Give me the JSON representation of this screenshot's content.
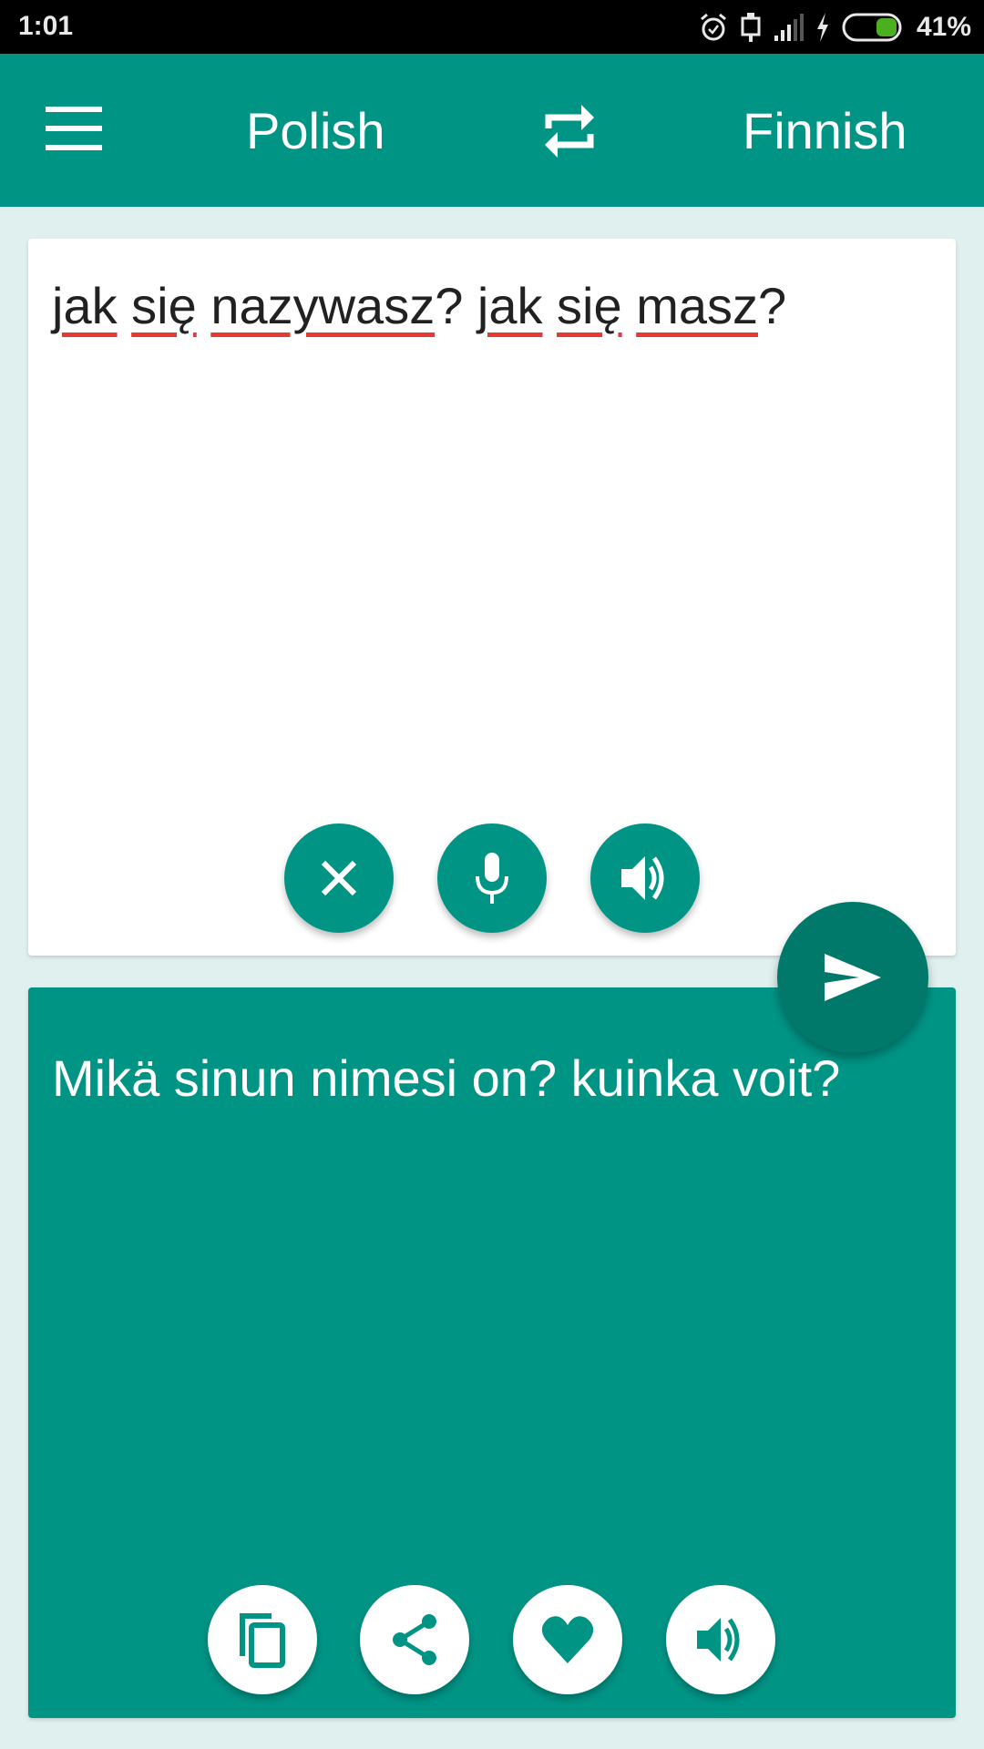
{
  "status_bar": {
    "time": "1:01",
    "battery_percent": "41%",
    "battery_level": 0.41,
    "icons": [
      "alarm-icon",
      "usb-icon",
      "signal-icon",
      "charging-icon",
      "battery-icon"
    ]
  },
  "header": {
    "menu_icon": "menu-icon",
    "source_language": "Polish",
    "swap_icon": "swap-icon",
    "target_language": "Finnish"
  },
  "input": {
    "words": [
      "jak",
      "się",
      "nazywasz",
      "jak",
      "się",
      "masz"
    ],
    "text": "jak się nazywasz? jak się masz?",
    "buttons": [
      {
        "name": "clear-button",
        "icon": "close-icon"
      },
      {
        "name": "microphone-button",
        "icon": "mic-icon"
      },
      {
        "name": "speak-source-button",
        "icon": "speaker-icon"
      }
    ]
  },
  "translate_button": {
    "icon": "send-icon"
  },
  "output": {
    "text": "Mikä sinun nimesi on? kuinka voit?",
    "buttons": [
      {
        "name": "copy-button",
        "icon": "copy-icon"
      },
      {
        "name": "share-button",
        "icon": "share-icon"
      },
      {
        "name": "favorite-button",
        "icon": "heart-icon"
      },
      {
        "name": "speak-translation-button",
        "icon": "speaker-icon"
      }
    ]
  },
  "colors": {
    "primary": "#009485",
    "primary_dark": "#00796b",
    "background": "#dff0ee",
    "spellcheck_underline": "#e53935"
  }
}
